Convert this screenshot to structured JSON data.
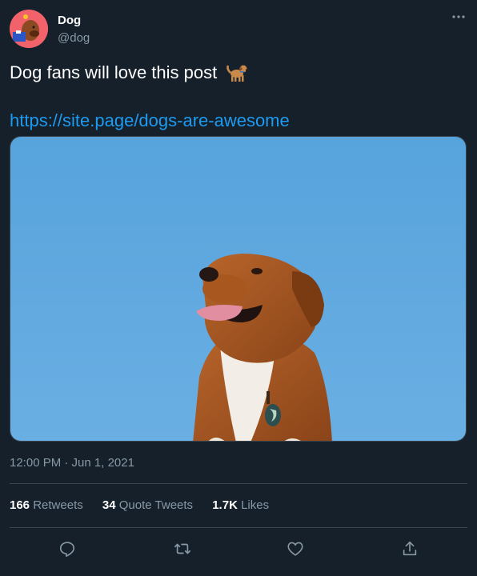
{
  "author": {
    "name": "Dog",
    "handle": "@dog",
    "avatar_color": "#f1626b"
  },
  "tweet": {
    "text": "Dog fans will love this post",
    "emoji": "dog-emoji",
    "link": "https://site.page/dogs-are-awesome",
    "image": "dog-photo",
    "timestamp": "12:00 PM · Jun 1, 2021"
  },
  "stats": {
    "retweets_count": "166",
    "retweets_label": "Retweets",
    "quotes_count": "34",
    "quotes_label": "Quote Tweets",
    "likes_count": "1.7K",
    "likes_label": "Likes"
  },
  "actions": [
    "reply-icon",
    "retweet-icon",
    "like-icon",
    "share-icon"
  ],
  "colors": {
    "background": "#15202b",
    "text": "#ffffff",
    "secondary_text": "#8899a6",
    "link": "#1d9bf0",
    "border": "#38444d"
  }
}
